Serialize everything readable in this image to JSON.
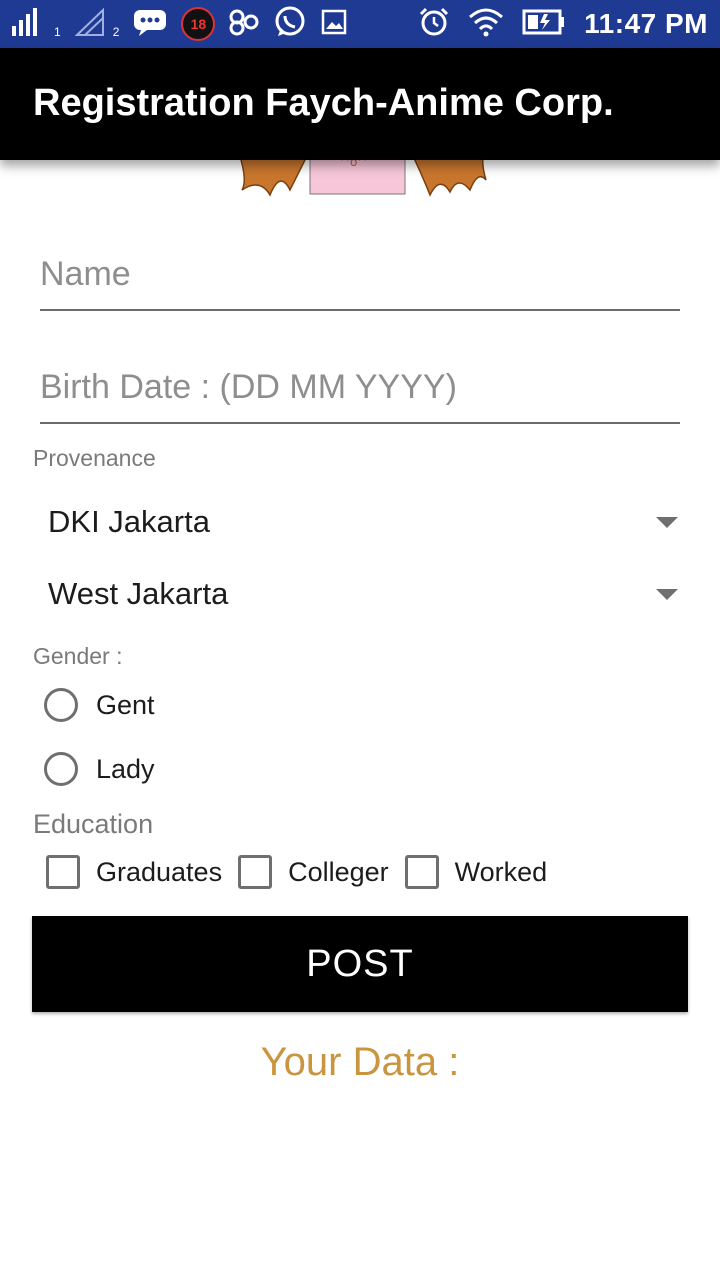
{
  "status_bar": {
    "time": "11:47 PM",
    "sim1": "1",
    "sim2": "2",
    "notif_count": "18",
    "icons": [
      "signal-icon",
      "signal-empty-icon",
      "chat-icon",
      "notification-badge",
      "app-icon",
      "whatsapp-icon",
      "gallery-icon",
      "alarm-icon",
      "wifi-icon",
      "battery-icon"
    ]
  },
  "appbar": {
    "title": "Registration Faych-Anime Corp."
  },
  "form": {
    "name_placeholder": "Name",
    "birth_placeholder": "Birth Date : (DD MM YYYY)",
    "provenance_label": "Provenance",
    "province": "DKI Jakarta",
    "city": "West Jakarta",
    "gender_label": "Gender :",
    "gender_options": [
      "Gent",
      "Lady"
    ],
    "education_label": "Education",
    "education_options": [
      "Graduates",
      "Colleger",
      "Worked"
    ],
    "post_label": "POST",
    "your_data_label": "Your Data :"
  },
  "colors": {
    "status_bar": "#1f3a93",
    "appbar": "#000000",
    "accent_text": "#c9953f"
  }
}
